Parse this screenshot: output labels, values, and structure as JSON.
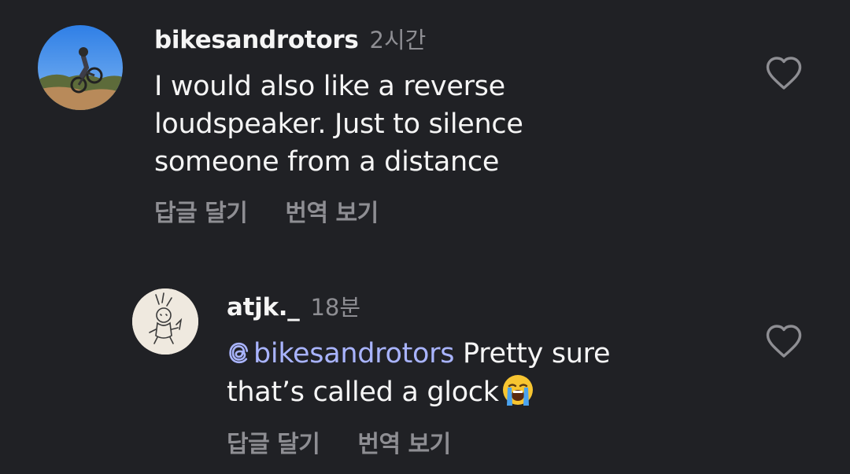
{
  "comments": [
    {
      "username": "bikesandrotors",
      "time": "2시간",
      "lines": [
        "I would also like a reverse",
        "loudspeaker. Just to silence",
        "someone from a distance"
      ],
      "reply_label": "답글 달기",
      "translate_label": "번역 보기",
      "like_icon": "heart-outline-icon"
    },
    {
      "username": "atjk._",
      "time": "18분",
      "mention": "bikesandrotors",
      "line1_text": " Pretty sure",
      "line2_text": "that’s called a glock",
      "emoji": "loudly-crying-face",
      "reply_label": "답글 달기",
      "translate_label": "번역 보기",
      "like_icon": "heart-outline-icon"
    }
  ],
  "colors": {
    "background": "#202125",
    "text": "#f5f5f5",
    "muted": "#8e8e93",
    "mention": "#a9b4ff"
  }
}
